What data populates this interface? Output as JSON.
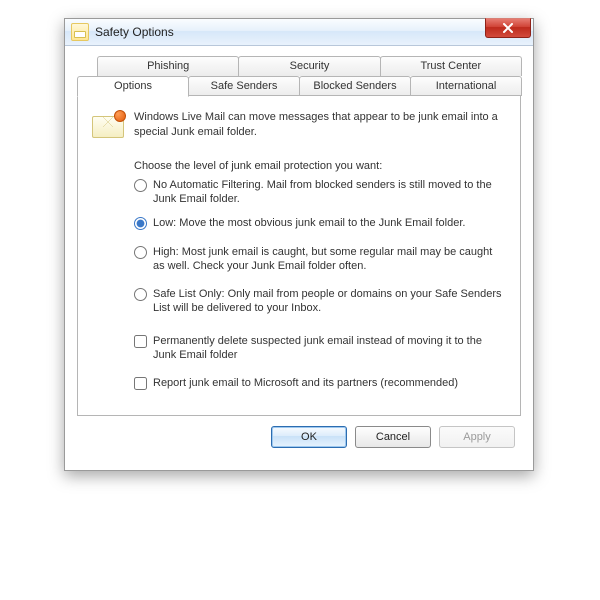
{
  "window": {
    "title": "Safety Options",
    "close_label": "Close"
  },
  "tabs_back": [
    {
      "label": "Phishing"
    },
    {
      "label": "Security"
    },
    {
      "label": "Trust Center"
    }
  ],
  "tabs_front": [
    {
      "label": "Options",
      "active": true
    },
    {
      "label": "Safe Senders"
    },
    {
      "label": "Blocked Senders"
    },
    {
      "label": "International"
    }
  ],
  "intro": "Windows Live Mail can move messages that appear to be junk email into a special Junk email folder.",
  "choose_label": "Choose the level of junk email protection you want:",
  "radios": {
    "none": "No Automatic Filtering.  Mail from blocked senders is still moved to the Junk Email folder.",
    "low": "Low: Move the most obvious junk email to the Junk Email folder.",
    "high": "High: Most junk email is caught, but some regular mail may be caught as well.  Check your Junk Email folder often.",
    "safe": "Safe List Only: Only mail from people or domains on your Safe Senders List will be delivered to your Inbox.",
    "selected": "low"
  },
  "checks": {
    "perm_delete": "Permanently delete suspected junk email instead of moving it to the Junk Email folder",
    "report_ms": "Report junk email to Microsoft and its partners (recommended)"
  },
  "buttons": {
    "ok": "OK",
    "cancel": "Cancel",
    "apply": "Apply"
  }
}
